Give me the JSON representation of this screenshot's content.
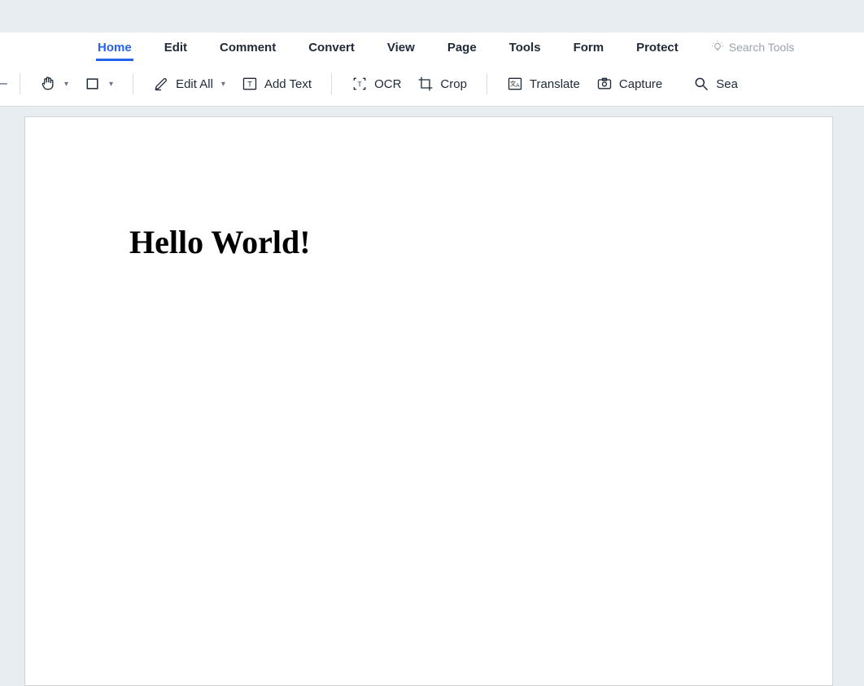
{
  "tabs": {
    "home": "Home",
    "edit": "Edit",
    "comment": "Comment",
    "convert": "Convert",
    "view": "View",
    "page": "Page",
    "tools": "Tools",
    "form": "Form",
    "protect": "Protect"
  },
  "search": {
    "placeholder": "Search Tools"
  },
  "toolbar": {
    "edit_all": "Edit All",
    "add_text": "Add Text",
    "ocr": "OCR",
    "crop": "Crop",
    "translate": "Translate",
    "capture": "Capture",
    "search": "Sea"
  },
  "document": {
    "content": "Hello World!"
  }
}
